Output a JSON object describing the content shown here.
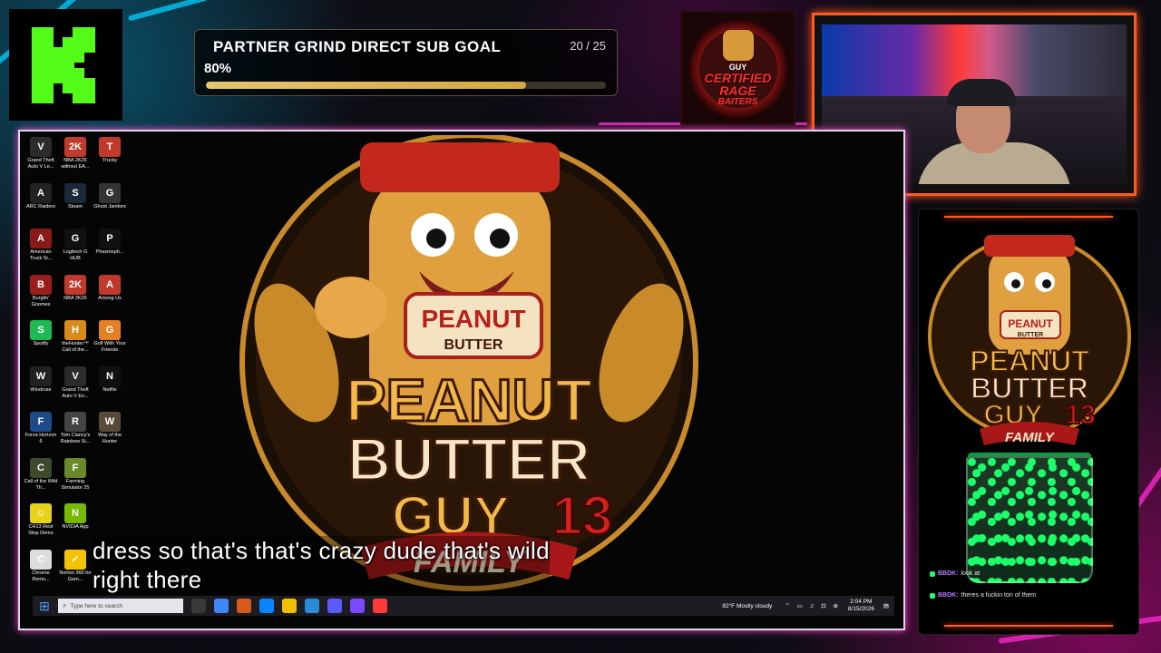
{
  "background": {
    "accent_cyan": "#00c8ff",
    "accent_magenta": "#ff00aa"
  },
  "kick_logo": {
    "letter": "K",
    "icon": "kick-logo-icon",
    "color": "#53fc18"
  },
  "sub_goal": {
    "title": "PARTNER GRIND DIRECT SUB GOAL",
    "count": "20 / 25",
    "percent_text": "80%",
    "progress": 0.8
  },
  "badge": {
    "line1": "GUY",
    "line2": "CERTIFIED",
    "line3": "RAGE",
    "line4": "BAITERS"
  },
  "desktop": {
    "icons": [
      {
        "label": "Grand Theft Auto V Le...",
        "color": "#2b2b2b",
        "glyph": "V"
      },
      {
        "label": "NBA 2K26 without EA...",
        "color": "#c0392b",
        "glyph": "2K"
      },
      {
        "label": "Trucky",
        "color": "#c0392b",
        "glyph": "T"
      },
      {
        "label": "ARC Raiders",
        "color": "#222",
        "glyph": "A"
      },
      {
        "label": "Steam",
        "color": "#1b2838",
        "glyph": "S"
      },
      {
        "label": "Ghost Janitors",
        "color": "#333",
        "glyph": "G"
      },
      {
        "label": "American Truck Si...",
        "color": "#8b1a1a",
        "glyph": "A"
      },
      {
        "label": "Logitech G HUB",
        "color": "#111",
        "glyph": "G"
      },
      {
        "label": "Phasmoph...",
        "color": "#111",
        "glyph": "P"
      },
      {
        "label": "Burglin' Gnomes",
        "color": "#9b1c1c",
        "glyph": "B"
      },
      {
        "label": "NBA 2K26",
        "color": "#c0392b",
        "glyph": "2K"
      },
      {
        "label": "Among Us",
        "color": "#c0392b",
        "glyph": "A"
      },
      {
        "label": "Spotify",
        "color": "#1db954",
        "glyph": "S"
      },
      {
        "label": "theHunter™ Call of the...",
        "color": "#d98b1a",
        "glyph": "H"
      },
      {
        "label": "Golf With Your Friends",
        "color": "#e67e22",
        "glyph": "G"
      },
      {
        "label": "Windrose",
        "color": "#222",
        "glyph": "W"
      },
      {
        "label": "Grand Theft Auto V En...",
        "color": "#2b2b2b",
        "glyph": "V"
      },
      {
        "label": "Netflix",
        "color": "#111",
        "glyph": "N"
      },
      {
        "label": "Forza Horizon 6",
        "color": "#1f4a8a",
        "glyph": "F"
      },
      {
        "label": "Tom Clancy's Rainbow Si...",
        "color": "#444",
        "glyph": "R"
      },
      {
        "label": "Way of the Hunter",
        "color": "#5a4a3a",
        "glyph": "W"
      },
      {
        "label": "Call of the Wild Th...",
        "color": "#3a4a2a",
        "glyph": "C"
      },
      {
        "label": "Farming Simulator 25",
        "color": "#6a8a2a",
        "glyph": "F"
      },
      {
        "label": "",
        "color": "transparent",
        "glyph": ""
      },
      {
        "label": "CH13 Rest Stop Demo",
        "color": "#e6d21a",
        "glyph": "☺"
      },
      {
        "label": "NVIDIA App",
        "color": "#76b900",
        "glyph": "N"
      },
      {
        "label": "",
        "color": "transparent",
        "glyph": ""
      },
      {
        "label": "Chrome Remo...",
        "color": "#dddddd",
        "glyph": "C"
      },
      {
        "label": "Norton 360 for Gam...",
        "color": "#f2c400",
        "glyph": "✓"
      },
      {
        "label": "",
        "color": "transparent",
        "glyph": ""
      }
    ]
  },
  "caption": {
    "line1": "dress so that's that's crazy dude that's wild",
    "line2": "right there"
  },
  "taskbar": {
    "search_placeholder": "Type here to search",
    "weather": "82°F  Mostly cloudy",
    "time": "2:04 PM",
    "date": "8/15/2026",
    "app_colors": [
      "#3a3a3a",
      "#4285f4",
      "#d85a1a",
      "#0a84ff",
      "#f0c000",
      "#2a8ad8",
      "#5a5aff",
      "#7a4aff",
      "#ff3a3a"
    ]
  },
  "chat": [
    {
      "user": "BBDK",
      "message": "look at"
    },
    {
      "user": "BBDK",
      "message": "theres a fuckin ton of them"
    }
  ]
}
